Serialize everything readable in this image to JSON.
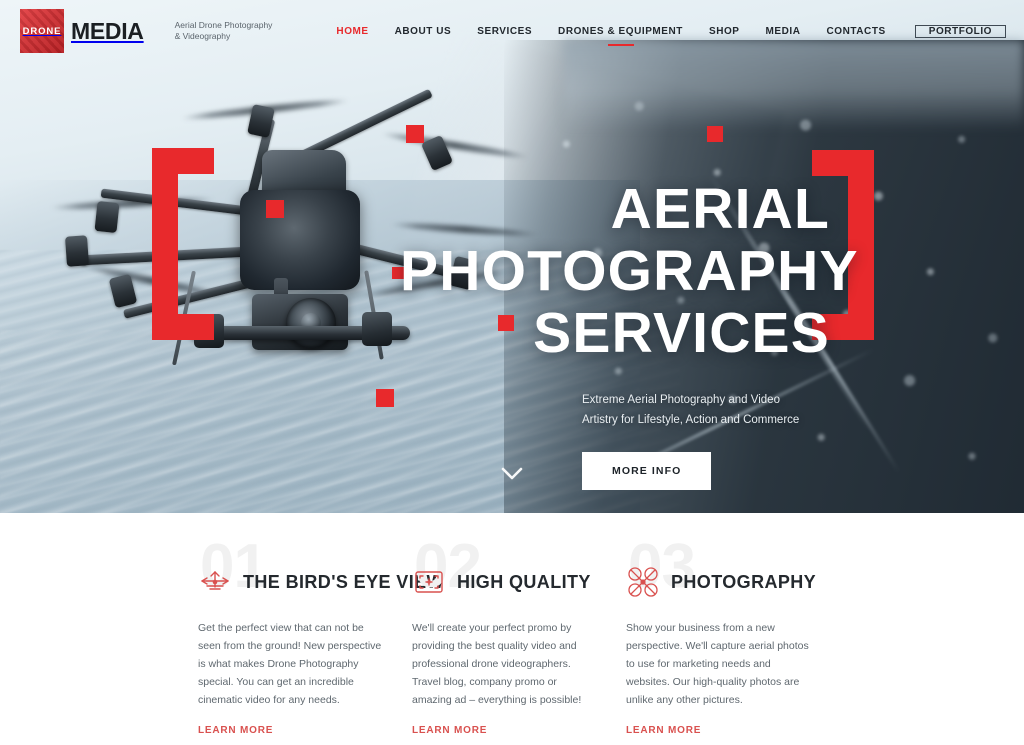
{
  "brand": {
    "mark_text": "DRONE",
    "word": "MEDIA",
    "tagline_line1": "Aerial Drone Photography",
    "tagline_line2": "& Videography"
  },
  "nav": {
    "items": [
      {
        "label": "HOME",
        "state": "active"
      },
      {
        "label": "ABOUT US",
        "state": "default"
      },
      {
        "label": "SERVICES",
        "state": "default"
      },
      {
        "label": "DRONES & EQUIPMENT",
        "state": "underlined"
      },
      {
        "label": "SHOP",
        "state": "default"
      },
      {
        "label": "MEDIA",
        "state": "default"
      },
      {
        "label": "CONTACTS",
        "state": "default"
      }
    ],
    "portfolio_button": "PORTFOLIO"
  },
  "hero": {
    "title_line1": "AERIAL PHOTOGRAPHY",
    "title_line2": "SERVICES",
    "subtitle": "Extreme Aerial Photography and Video Artistry for Lifestyle, Action and Commerce",
    "cta": "MORE INFO",
    "scroll_icon": "chevron-down-icon"
  },
  "features": [
    {
      "number": "01",
      "icon": "drone-front-icon",
      "title": "THE BIRD'S EYE VIEW",
      "body": "Get the perfect view that can not be seen from the ground! New perspective is what makes Drone Photography special. You can get an incredible cinematic video for any needs.",
      "link": "LEARN MORE"
    },
    {
      "number": "02",
      "icon": "camera-focus-frame-icon",
      "title": "HIGH QUALITY",
      "body": "We'll create your perfect promo by providing the best quality video and professional drone videographers. Travel blog, company promo or amazing ad – everything is possible!",
      "link": "LEARN MORE"
    },
    {
      "number": "03",
      "icon": "quadcopter-icon",
      "title": "PHOTOGRAPHY",
      "body": "Show your business from a new perspective. We'll capture aerial photos to use for marketing needs and websites. Our high-quality photos are unlike any other pictures.",
      "link": "LEARN MORE"
    }
  ],
  "colors": {
    "accent_red": "#e8292c",
    "link_red": "#d9514f",
    "heading_dark": "#24292e"
  }
}
